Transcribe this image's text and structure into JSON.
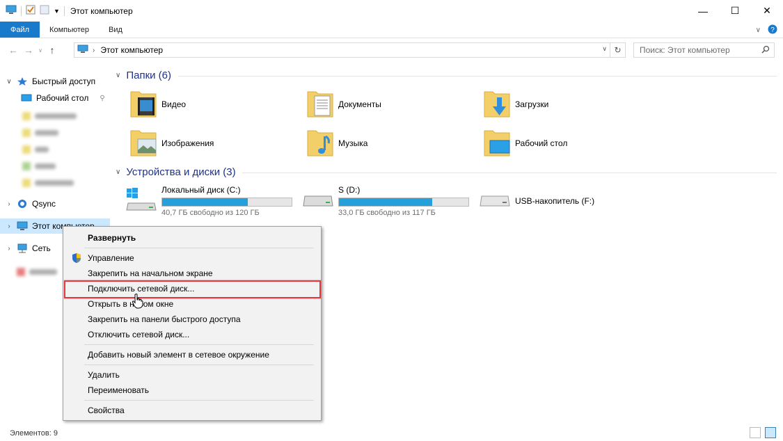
{
  "window": {
    "title": "Этот компьютер",
    "controls": {
      "minimize": "—",
      "maximize": "☐",
      "close": "✕"
    }
  },
  "ribbon": {
    "tabs": [
      "Файл",
      "Компьютер",
      "Вид"
    ]
  },
  "address": {
    "path": "Этот компьютер",
    "search_placeholder": "Поиск: Этот компьютер"
  },
  "nav": {
    "quick_access": "Быстрый доступ",
    "desktop": "Рабочий стол",
    "qsync": "Qsync",
    "this_pc": "Этот компьютер",
    "network": "Сеть"
  },
  "groups": {
    "folders_header": "Папки (6)",
    "devices_header": "Устройства и диски (3)"
  },
  "folders": [
    {
      "name": "Видео",
      "icon": "video-folder-icon"
    },
    {
      "name": "Документы",
      "icon": "documents-folder-icon"
    },
    {
      "name": "Загрузки",
      "icon": "downloads-folder-icon"
    },
    {
      "name": "Изображения",
      "icon": "pictures-folder-icon"
    },
    {
      "name": "Музыка",
      "icon": "music-folder-icon"
    },
    {
      "name": "Рабочий стол",
      "icon": "desktop-folder-icon"
    }
  ],
  "drives": [
    {
      "name": "Локальный диск (C:)",
      "free": "40,7 ГБ свободно из 120 ГБ",
      "used_fraction": 0.66
    },
    {
      "name": "S (D:)",
      "free": "33,0 ГБ свободно из 117 ГБ",
      "used_fraction": 0.72
    },
    {
      "name": "USB-накопитель (F:)"
    }
  ],
  "context_menu": {
    "expand": "Развернуть",
    "manage": "Управление",
    "pin_start": "Закрепить на начальном экране",
    "map_drive": "Подключить сетевой диск...",
    "open_new_window": "Открыть в новом окне",
    "pin_quick": "Закрепить на панели быстрого доступа",
    "disconnect_drive": "Отключить сетевой диск...",
    "add_network_location": "Добавить новый элемент в сетевое окружение",
    "delete": "Удалить",
    "rename": "Переименовать",
    "properties": "Свойства"
  },
  "status": {
    "items": "Элементов: 9"
  },
  "colors": {
    "accent": "#1979ca",
    "group_header": "#1e3287",
    "drive_fill": "#26a0da",
    "highlight_border": "#e0393f",
    "selection": "#cce8ff"
  }
}
